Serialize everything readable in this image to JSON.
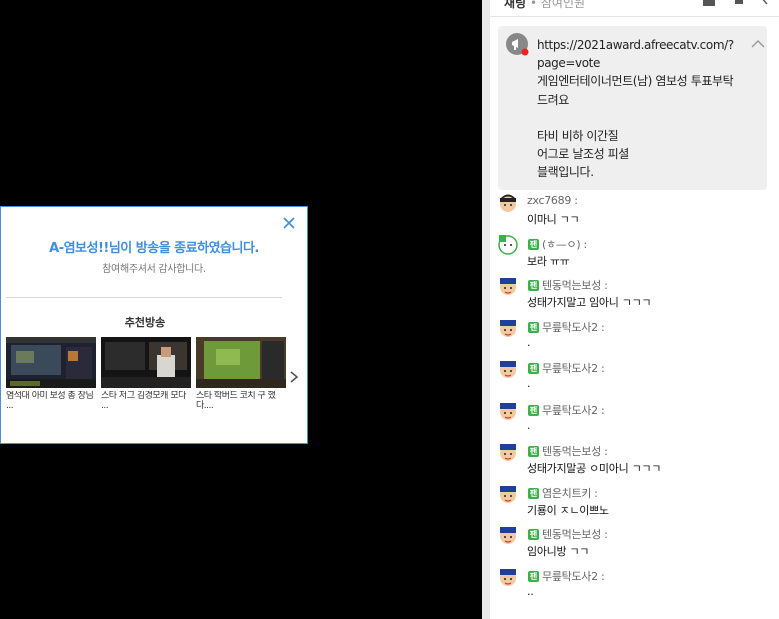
{
  "end_modal": {
    "title": "A-염보성!!님이 방송을 종료하였습니다.",
    "subtitle": "참여해주셔서 감사합니다.",
    "recommend_title": "추천방송",
    "items": [
      {
        "label": "염석대 아미 보성 총 장님 ..."
      },
      {
        "label": "스타 저그 김경모캐 모다 ..."
      },
      {
        "label": "스타 학버드 코치 구 했다...."
      }
    ],
    "colors": {
      "accent": "#3d8fe0",
      "border": "#4a90d9"
    }
  },
  "chat": {
    "top_label": "채팅",
    "top_sub": "• 참여인원",
    "notice": {
      "text": "https://2021award.afreecatv.com/?\npage=vote\n게임엔터테이너먼트(남) 염보성 투표부탁\n드려요\n\n타비 비하 이간질\n어그로 날조성 피셜\n블랙입니다."
    },
    "messages": [
      {
        "nick": "zxc7689 :",
        "text": "이마니 ㄱㄱ",
        "fan": false,
        "avatar": "plain"
      },
      {
        "nick": "(ㅎ—ㅇ) :",
        "text": "보라 ㅠㅠ",
        "fan": true,
        "avatar": "green"
      },
      {
        "nick": "텐동먹는보성 :",
        "text": "성태가지말고 임아니 ㄱㄱㄱ",
        "fan": true,
        "avatar": "fan"
      },
      {
        "nick": "무릎탁도사2 :",
        "text": ".",
        "fan": true,
        "avatar": "fan"
      },
      {
        "nick": "무릎탁도사2 :",
        "text": ".",
        "fan": true,
        "avatar": "fan"
      },
      {
        "nick": "무릎탁도사2 :",
        "text": ".",
        "fan": true,
        "avatar": "fan"
      },
      {
        "nick": "텐동먹는보성 :",
        "text": "성태가지말공 ㅇ미아니 ㄱㄱㄱ",
        "fan": true,
        "avatar": "fan"
      },
      {
        "nick": "염은치트키 :",
        "text": "기룡이 ㅈㄴ이쁘노",
        "fan": true,
        "avatar": "fan"
      },
      {
        "nick": "텐동먹는보성 :",
        "text": "임아니방 ㄱㄱ",
        "fan": true,
        "avatar": "fan"
      },
      {
        "nick": "무릎탁도사2 :",
        "text": "..",
        "fan": true,
        "avatar": "fan"
      }
    ],
    "fan_badge": "팬"
  }
}
